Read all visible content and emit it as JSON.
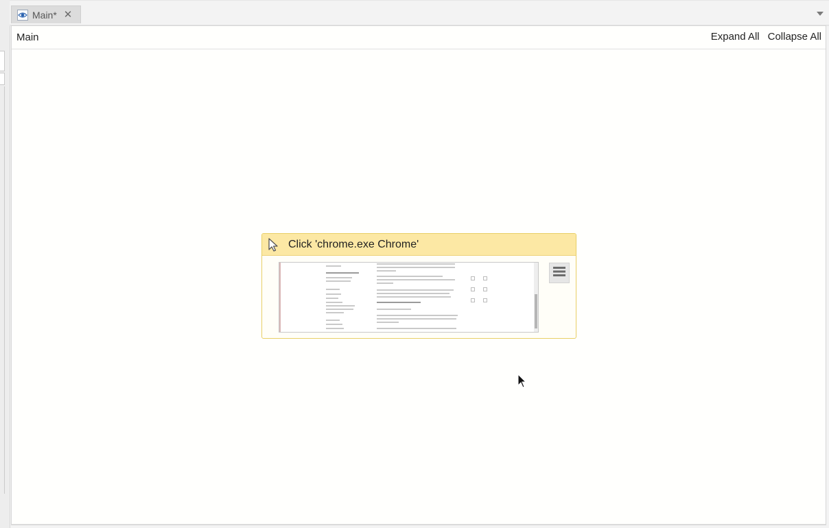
{
  "tab": {
    "label": "Main*",
    "close_glyph": "✕",
    "icon": "eye-icon"
  },
  "designer": {
    "breadcrumb": "Main",
    "expand_all": "Expand All",
    "collapse_all": "Collapse All"
  },
  "activity": {
    "title": "Click 'chrome.exe Chrome'",
    "icon": "cursor-click-icon",
    "menu_icon": "hamburger-menu-icon"
  },
  "colors": {
    "activity_header_bg": "#fce8a4",
    "activity_border": "#e8cf64",
    "canvas_bg": "#fffffd"
  }
}
